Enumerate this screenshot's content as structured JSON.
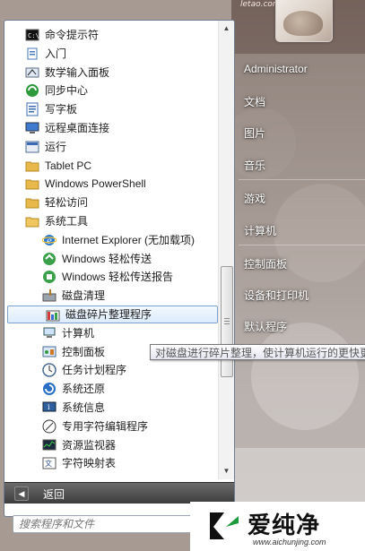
{
  "watermark_top": "letao.com",
  "programs": [
    {
      "label": "命令提示符",
      "icon": "cmd-icon",
      "indent": 0
    },
    {
      "label": "入门",
      "icon": "getting-started-icon",
      "indent": 0
    },
    {
      "label": "数学输入面板",
      "icon": "math-input-icon",
      "indent": 0
    },
    {
      "label": "同步中心",
      "icon": "sync-center-icon",
      "indent": 0
    },
    {
      "label": "写字板",
      "icon": "wordpad-icon",
      "indent": 0
    },
    {
      "label": "远程桌面连接",
      "icon": "remote-desktop-icon",
      "indent": 0
    },
    {
      "label": "运行",
      "icon": "run-icon",
      "indent": 0
    },
    {
      "label": "Tablet PC",
      "icon": "folder-icon",
      "indent": 0
    },
    {
      "label": "Windows PowerShell",
      "icon": "folder-icon",
      "indent": 0
    },
    {
      "label": "轻松访问",
      "icon": "folder-icon",
      "indent": 0
    },
    {
      "label": "系统工具",
      "icon": "folder-open-icon",
      "indent": 0
    },
    {
      "label": "Internet Explorer (无加载项)",
      "icon": "ie-icon",
      "indent": 1
    },
    {
      "label": "Windows 轻松传送",
      "icon": "easy-transfer-icon",
      "indent": 1
    },
    {
      "label": "Windows 轻松传送报告",
      "icon": "easy-transfer-report-icon",
      "indent": 1
    },
    {
      "label": "磁盘清理",
      "icon": "disk-cleanup-icon",
      "indent": 1
    },
    {
      "label": "磁盘碎片整理程序",
      "icon": "defrag-icon",
      "indent": 1,
      "selected": true
    },
    {
      "label": "计算机",
      "icon": "computer-icon",
      "indent": 1
    },
    {
      "label": "控制面板",
      "icon": "control-panel-icon",
      "indent": 1
    },
    {
      "label": "任务计划程序",
      "icon": "task-scheduler-icon",
      "indent": 1
    },
    {
      "label": "系统还原",
      "icon": "system-restore-icon",
      "indent": 1
    },
    {
      "label": "系统信息",
      "icon": "system-info-icon",
      "indent": 1
    },
    {
      "label": "专用字符编辑程序",
      "icon": "char-editor-icon",
      "indent": 1
    },
    {
      "label": "资源监视器",
      "icon": "resource-monitor-icon",
      "indent": 1
    },
    {
      "label": "字符映射表",
      "icon": "char-map-icon",
      "indent": 1
    }
  ],
  "back_label": "返回",
  "search_placeholder": "搜索程序和文件",
  "tooltip": "对磁盘进行碎片整理，使计算机运行的更快更",
  "right_menu": [
    {
      "label": "Administrator"
    },
    {
      "label": "文档"
    },
    {
      "label": "图片"
    },
    {
      "label": "音乐"
    },
    {
      "label": "游戏"
    },
    {
      "label": "计算机"
    },
    {
      "label": "控制面板"
    },
    {
      "label": "设备和打印机"
    },
    {
      "label": "默认程序"
    }
  ],
  "brand": {
    "name": "爱纯净",
    "url": "www.aichunjing.com"
  },
  "colors": {
    "folder": "#e8b84a",
    "selection_border": "#7da2ce",
    "back_bar": "#4a4a4a"
  }
}
